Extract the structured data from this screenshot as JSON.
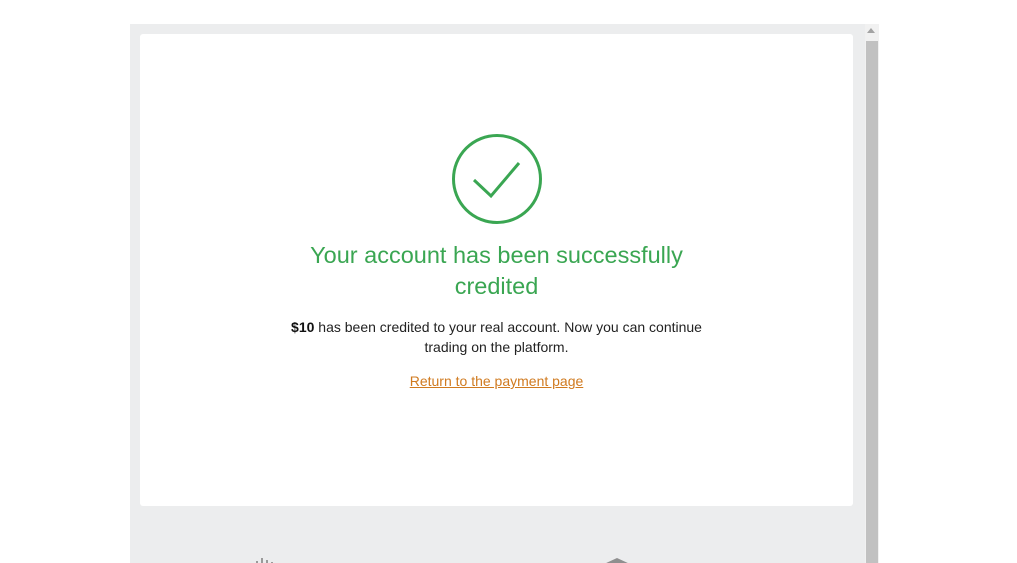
{
  "payment_result": {
    "status": "success",
    "headline": "Your account has been successfully credited",
    "amount": "$10",
    "message_rest": " has been credited to your real account. Now you can continue trading on the platform.",
    "return_link_label": "Return to the payment page"
  },
  "colors": {
    "success_green": "#3aa652",
    "link_orange": "#d07a1f",
    "frame_bg": "#ecedee"
  },
  "icons": {
    "status": "check-circle-icon",
    "footer": [
      "sparkle-icon",
      "caret-up-icon",
      "shield-icon"
    ]
  }
}
